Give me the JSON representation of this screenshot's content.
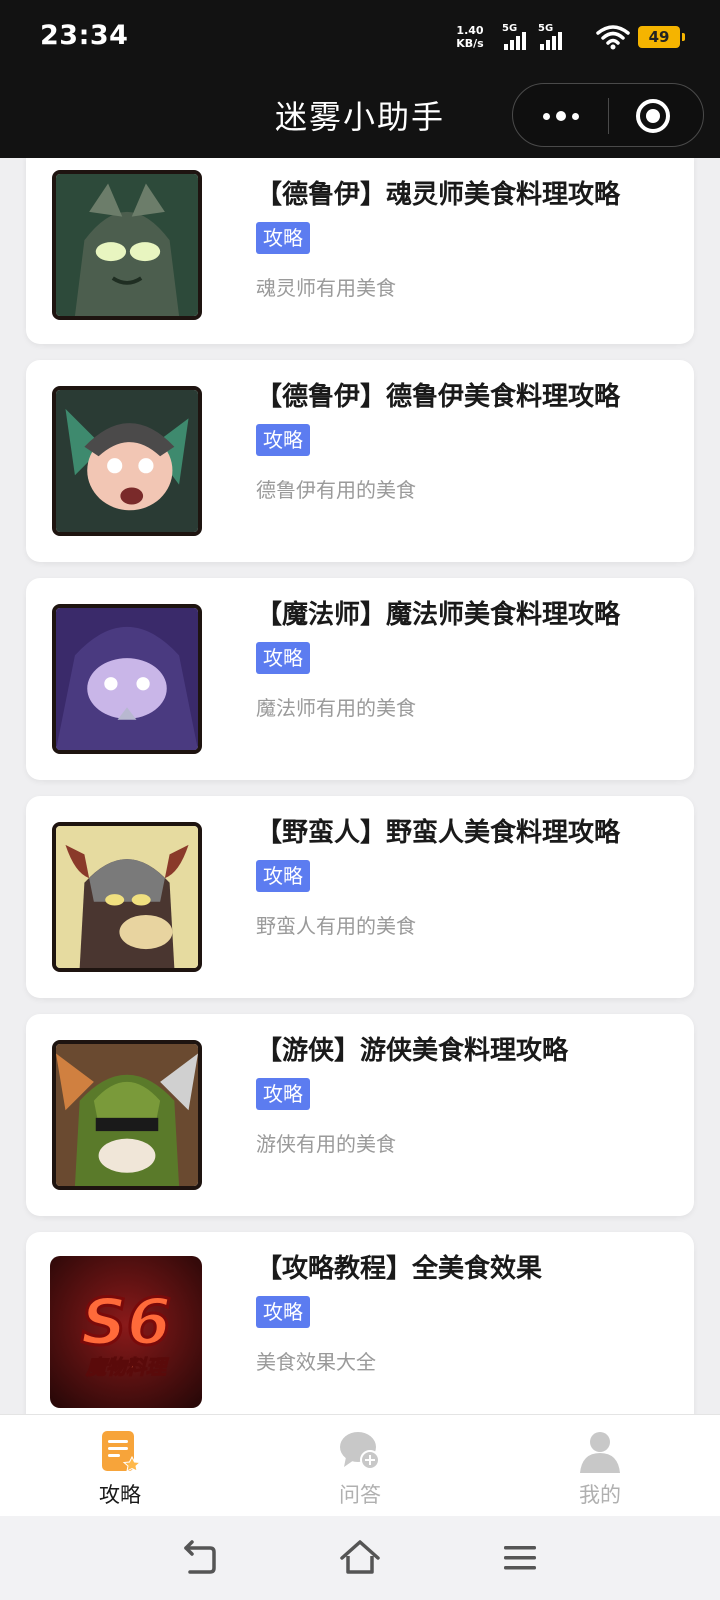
{
  "status_bar": {
    "time": "23:34",
    "net_speed_value": "1.40",
    "net_speed_unit": "KB/s",
    "signal1_label": "5G",
    "signal2_label": "5G",
    "battery": "49",
    "battery_color": "#f5b400"
  },
  "header": {
    "title": "迷雾小助手",
    "more_icon": "more-dots-icon",
    "close_icon": "target-close-icon"
  },
  "articles": [
    {
      "title": "【德鲁伊】魂灵师美食料理攻略",
      "tag": "攻略",
      "desc": "魂灵师有用美食"
    },
    {
      "title": "【德鲁伊】德鲁伊美食料理攻略",
      "tag": "攻略",
      "desc": "德鲁伊有用的美食"
    },
    {
      "title": "【魔法师】魔法师美食料理攻略",
      "tag": "攻略",
      "desc": "魔法师有用的美食"
    },
    {
      "title": "【野蛮人】野蛮人美食料理攻略",
      "tag": "攻略",
      "desc": "野蛮人有用的美食"
    },
    {
      "title": "【游侠】游侠美食料理攻略",
      "tag": "攻略",
      "desc": "游侠有用的美食"
    },
    {
      "title": "【攻略教程】全美食效果",
      "tag": "攻略",
      "desc": "美食效果大全",
      "thumb_big_text": "S6",
      "thumb_sub_text": "魔物料理"
    }
  ],
  "tabs": [
    {
      "label": "攻略",
      "icon": "guide-icon",
      "active": true
    },
    {
      "label": "问答",
      "icon": "chat-icon",
      "active": false
    },
    {
      "label": "我的",
      "icon": "user-icon",
      "active": false
    }
  ],
  "colors": {
    "tag_bg": "#5c7cf0",
    "active_tab_icon": "#f7a43a",
    "inactive_tab_icon": "#c8c8c8"
  }
}
